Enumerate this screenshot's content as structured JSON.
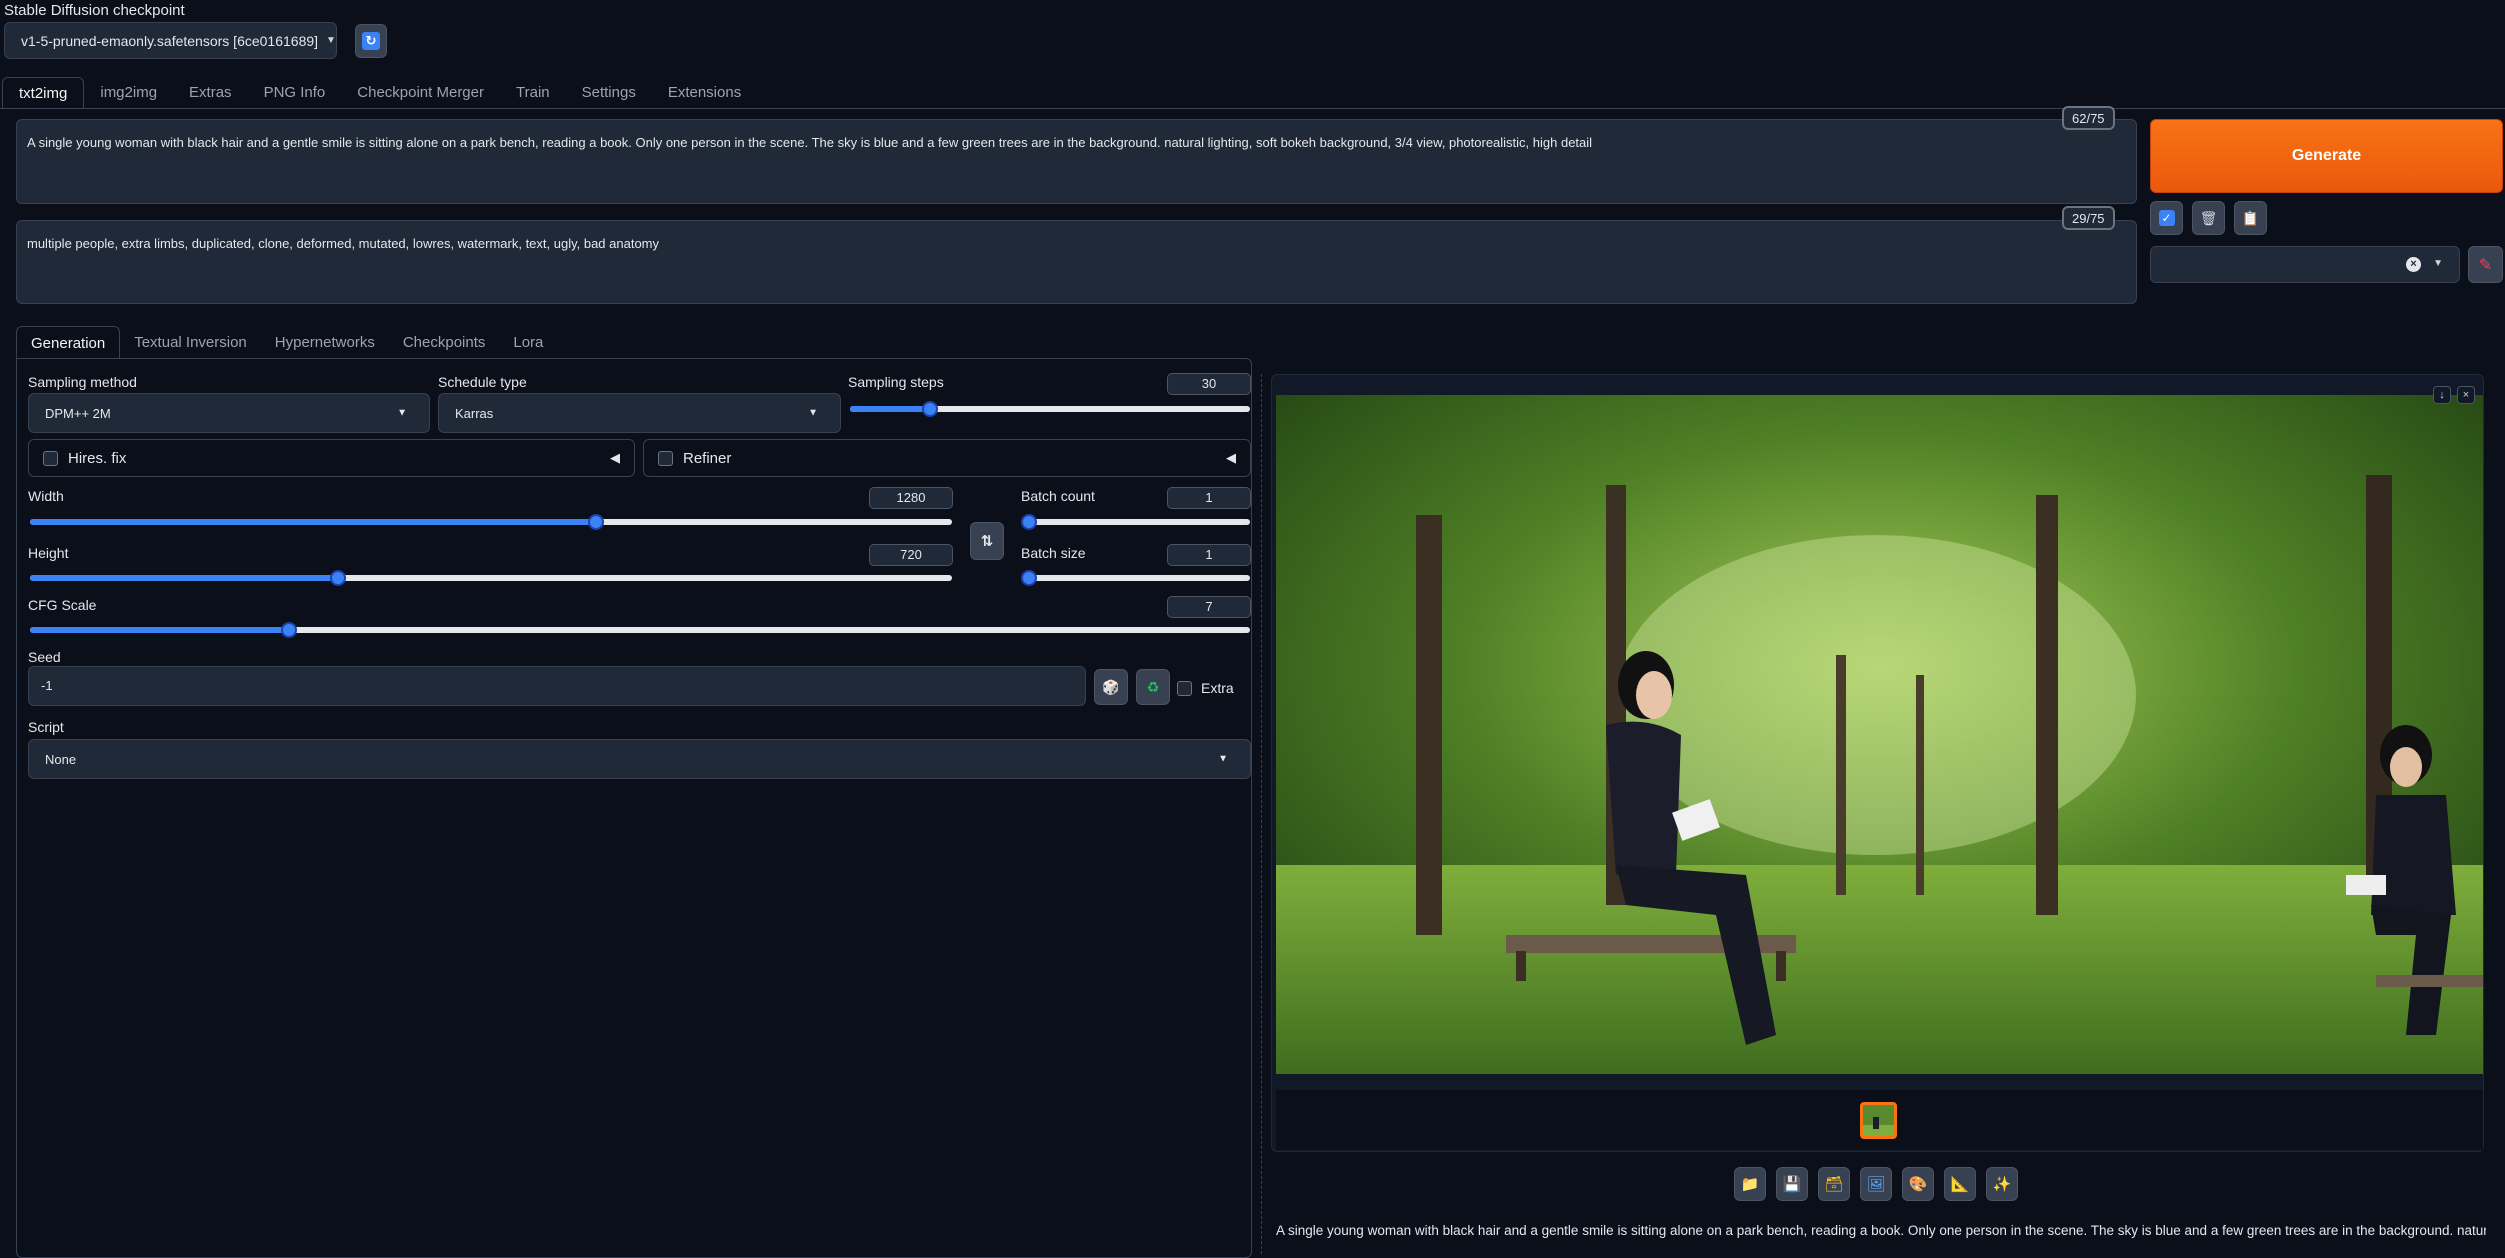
{
  "checkpoint": {
    "label": "Stable Diffusion checkpoint",
    "value": "v1-5-pruned-emaonly.safetensors [6ce0161689]"
  },
  "main_tabs": [
    {
      "label": "txt2img",
      "active": true
    },
    {
      "label": "img2img"
    },
    {
      "label": "Extras"
    },
    {
      "label": "PNG Info"
    },
    {
      "label": "Checkpoint Merger"
    },
    {
      "label": "Train"
    },
    {
      "label": "Settings"
    },
    {
      "label": "Extensions"
    }
  ],
  "prompt": {
    "text": "A single young woman with black hair and a gentle smile is sitting alone on a park bench, reading a book. Only one person in the scene. The sky is blue and a few green trees are in the background. natural lighting, soft bokeh background, 3/4 view, photorealistic, high detail",
    "token_count": "62/75"
  },
  "negative_prompt": {
    "text": "multiple people, extra limbs, duplicated, clone, deformed, mutated, lowres, watermark, text, ugly, bad anatomy",
    "token_count": "29/75"
  },
  "generate_label": "Generate",
  "sub_tabs": [
    {
      "label": "Generation",
      "active": true
    },
    {
      "label": "Textual Inversion"
    },
    {
      "label": "Hypernetworks"
    },
    {
      "label": "Checkpoints"
    },
    {
      "label": "Lora"
    }
  ],
  "generation": {
    "sampling_method": {
      "label": "Sampling method",
      "value": "DPM++ 2M"
    },
    "schedule_type": {
      "label": "Schedule type",
      "value": "Karras"
    },
    "sampling_steps": {
      "label": "Sampling steps",
      "value": "30",
      "fraction": 0.2
    },
    "hires_fix": {
      "label": "Hires. fix"
    },
    "refiner": {
      "label": "Refiner"
    },
    "width": {
      "label": "Width",
      "value": "1280",
      "fraction": 0.614
    },
    "height": {
      "label": "Height",
      "value": "720",
      "fraction": 0.334
    },
    "batch_count": {
      "label": "Batch count",
      "value": "1",
      "fraction": 0.0
    },
    "batch_size": {
      "label": "Batch size",
      "value": "1",
      "fraction": 0.0
    },
    "cfg_scale": {
      "label": "CFG Scale",
      "value": "7",
      "fraction": 0.212
    },
    "seed": {
      "label": "Seed",
      "value": "-1",
      "extra_label": "Extra"
    },
    "script": {
      "label": "Script",
      "value": "None"
    }
  },
  "gallery": {
    "info_text": "A single young woman with black hair and a gentle smile is sitting alone on a park bench, reading a book. Only one person in the scene. The sky is blue and a few green trees are in the background. natural",
    "tool_icons": [
      "folder-icon",
      "save-icon",
      "zip-icon",
      "image-icon",
      "palette-icon",
      "ruler-icon",
      "sparkle-icon"
    ]
  },
  "colors": {
    "accent": "#f97316",
    "slider": "#3b82f6",
    "background": "#0b0f19",
    "panel": "#1f2937"
  }
}
